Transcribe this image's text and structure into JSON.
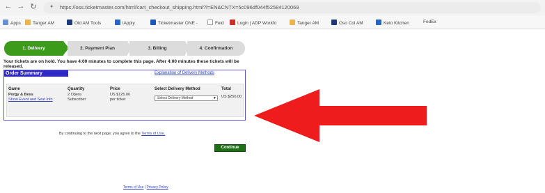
{
  "browser": {
    "url": "https://oss.ticketmaster.com/html/cart_checkout_shipping.html?l=EN&CNTX=5c096df044f52584120069",
    "bookmarks": [
      "Apps",
      "Tanger AM",
      "Old AM Tools",
      "iApply",
      "Ticketmaster ONE -",
      "Feld",
      "Login | ADP Workfo",
      "Tanger AM",
      "Oso Col AM",
      "Keto Kitchen",
      "FedEx"
    ]
  },
  "steps": [
    "1. Delivery",
    "2. Payment Plan",
    "3. Billing",
    "4. Confirmation"
  ],
  "hold_notice": "Your tickets are on hold. You have 4:00 minutes to complete this page. After 4:00 minutes these tickets will be released.",
  "order_summary": {
    "title": "Order Summary",
    "delivery_link": "Explanation of Delivery Methods",
    "columns": [
      "Game",
      "Quantity",
      "Price",
      "Select Delivery Method",
      "Total"
    ],
    "row": {
      "game": "Porgy & Bess",
      "game_link": "Show Event and Seat Info",
      "quantity": "2 Opera",
      "quantity_type": "Subscriber",
      "price": "US $125.00",
      "price_unit": "per ticket",
      "delivery_select": "Select Delivery Method",
      "total": "US $250.00"
    }
  },
  "agree": {
    "text": "By continuing to the next page, you agree to the",
    "terms_link": "Terms of Use."
  },
  "continue_label": "Continue",
  "footer": {
    "terms": "Terms of Use",
    "separator": "|",
    "privacy": "Privacy Policy"
  },
  "colors": {
    "step_active": "#3c9b1b",
    "summary_title": "#2f2ac4",
    "continue_button": "#1e6f16",
    "annotation_arrow": "#ee1c1c"
  }
}
